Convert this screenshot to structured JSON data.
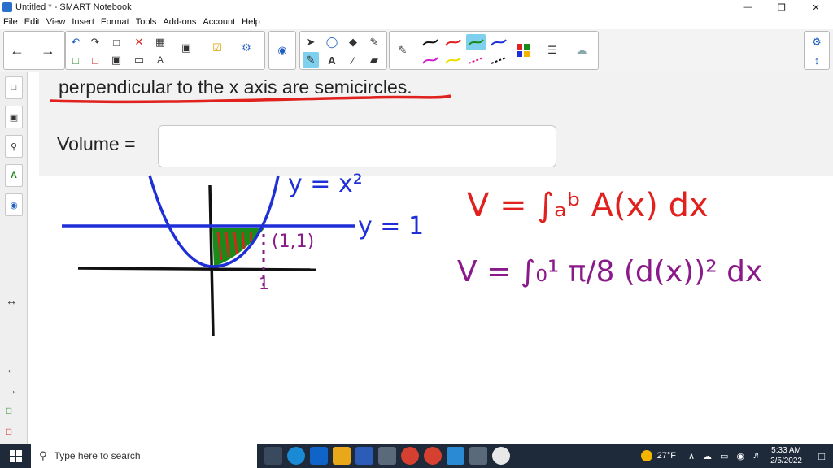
{
  "window": {
    "title": "Untitled * - SMART Notebook",
    "min": "—",
    "max": "❐",
    "close": "✕"
  },
  "menu": [
    "File",
    "Edit",
    "View",
    "Insert",
    "Format",
    "Tools",
    "Add-ons",
    "Account",
    "Help"
  ],
  "question": {
    "text": "perpendicular to the x axis are semicircles.",
    "volume_label": "Volume =",
    "volume_value": ""
  },
  "handwriting": {
    "curve_label": "y = x²",
    "line_label": "y = 1",
    "point_label": "(1,1)",
    "tick_label": "1",
    "formula1": "V = ∫ₐᵇ A(x) dx",
    "formula2": "V = ∫₀¹ π/8 (d(x))² dx"
  },
  "colors": {
    "blue_ink": "#1f2fd8",
    "red_ink": "#e0211e",
    "green_ink": "#1a8a1a",
    "purple_ink": "#8a1a8a",
    "black_ink": "#111111",
    "taskbar": "#1e2a3a",
    "selection": "#7fd0ee"
  },
  "taskbar": {
    "search_placeholder": "Type here to search",
    "temperature": "27°F",
    "time": "5:33 AM",
    "date": "2/5/2022"
  },
  "icons": {
    "toolbar": [
      "back-arrow",
      "forward-arrow",
      "undo",
      "redo",
      "paste",
      "delete",
      "table",
      "screen-shade",
      "document-camera",
      "magic-pen",
      "select",
      "shapes",
      "fill",
      "text",
      "line",
      "eraser",
      "pen",
      "color-swatches",
      "properties",
      "gallery",
      "settings"
    ],
    "sidebar": [
      "page-sorter",
      "gallery",
      "attachments",
      "properties",
      "add-ons"
    ]
  }
}
